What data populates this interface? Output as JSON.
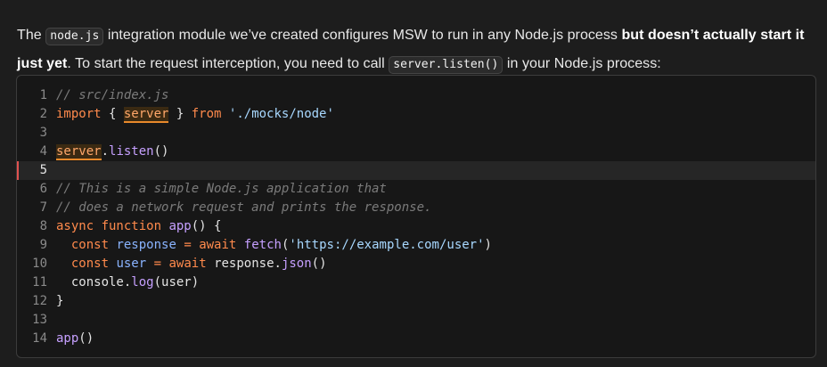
{
  "paragraph": {
    "t1": "The ",
    "code1": "node.js",
    "t2": " integration module we’ve created configures MSW to run in any Node.js process ",
    "bold1": "but doesn’t actually start it just yet",
    "t3": ". To start the request interception, you need to call ",
    "code2": "server.listen()",
    "t4": " in your Node.js process:"
  },
  "code": {
    "lines": [
      {
        "n": "1",
        "tokens": [
          {
            "c": "comment",
            "t": "// src/index.js"
          }
        ]
      },
      {
        "n": "2",
        "tokens": [
          {
            "c": "kw",
            "t": "import"
          },
          {
            "c": "plain",
            "t": " { "
          },
          {
            "c": "hl",
            "t": "server"
          },
          {
            "c": "plain",
            "t": " } "
          },
          {
            "c": "kw",
            "t": "from"
          },
          {
            "c": "plain",
            "t": " "
          },
          {
            "c": "str",
            "t": "'./mocks/node'"
          }
        ]
      },
      {
        "n": "3",
        "tokens": []
      },
      {
        "n": "4",
        "tokens": [
          {
            "c": "hl",
            "t": "server"
          },
          {
            "c": "plain",
            "t": "."
          },
          {
            "c": "fn",
            "t": "listen"
          },
          {
            "c": "plain",
            "t": "()"
          }
        ]
      },
      {
        "n": "5",
        "active": true,
        "tokens": []
      },
      {
        "n": "6",
        "tokens": [
          {
            "c": "comment",
            "t": "// This is a simple Node.js application that"
          }
        ]
      },
      {
        "n": "7",
        "tokens": [
          {
            "c": "comment",
            "t": "// does a network request and prints the response."
          }
        ]
      },
      {
        "n": "8",
        "tokens": [
          {
            "c": "kw",
            "t": "async function"
          },
          {
            "c": "plain",
            "t": " "
          },
          {
            "c": "fn",
            "t": "app"
          },
          {
            "c": "plain",
            "t": "() {"
          }
        ]
      },
      {
        "n": "9",
        "tokens": [
          {
            "c": "plain",
            "t": "  "
          },
          {
            "c": "kw",
            "t": "const"
          },
          {
            "c": "plain",
            "t": " "
          },
          {
            "c": "var",
            "t": "response"
          },
          {
            "c": "plain",
            "t": " "
          },
          {
            "c": "kw",
            "t": "="
          },
          {
            "c": "plain",
            "t": " "
          },
          {
            "c": "kw",
            "t": "await"
          },
          {
            "c": "plain",
            "t": " "
          },
          {
            "c": "fn",
            "t": "fetch"
          },
          {
            "c": "plain",
            "t": "("
          },
          {
            "c": "str",
            "t": "'https://example.com/user'"
          },
          {
            "c": "plain",
            "t": ")"
          }
        ]
      },
      {
        "n": "10",
        "tokens": [
          {
            "c": "plain",
            "t": "  "
          },
          {
            "c": "kw",
            "t": "const"
          },
          {
            "c": "plain",
            "t": " "
          },
          {
            "c": "var",
            "t": "user"
          },
          {
            "c": "plain",
            "t": " "
          },
          {
            "c": "kw",
            "t": "="
          },
          {
            "c": "plain",
            "t": " "
          },
          {
            "c": "kw",
            "t": "await"
          },
          {
            "c": "plain",
            "t": " response."
          },
          {
            "c": "fn",
            "t": "json"
          },
          {
            "c": "plain",
            "t": "()"
          }
        ]
      },
      {
        "n": "11",
        "tokens": [
          {
            "c": "plain",
            "t": "  console."
          },
          {
            "c": "fn",
            "t": "log"
          },
          {
            "c": "plain",
            "t": "(user)"
          }
        ]
      },
      {
        "n": "12",
        "tokens": [
          {
            "c": "plain",
            "t": "}"
          }
        ]
      },
      {
        "n": "13",
        "tokens": []
      },
      {
        "n": "14",
        "tokens": [
          {
            "c": "fn",
            "t": "app"
          },
          {
            "c": "plain",
            "t": "()"
          }
        ]
      }
    ]
  }
}
